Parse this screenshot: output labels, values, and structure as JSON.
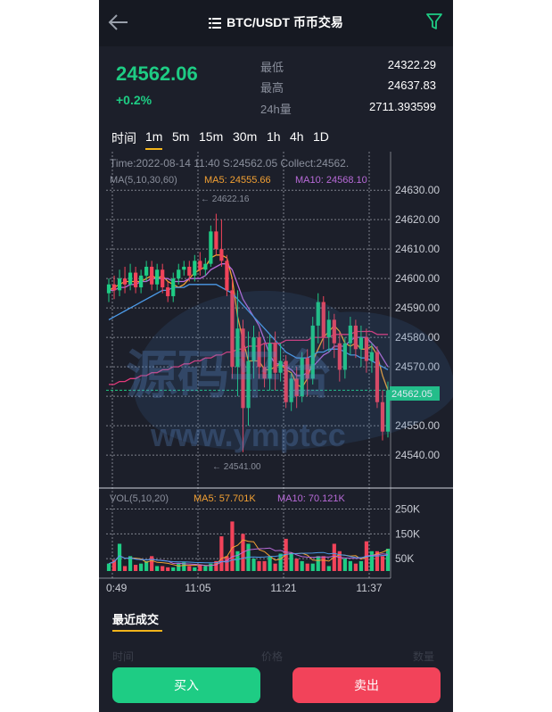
{
  "header": {
    "title": "BTC/USDT 币币交易",
    "back_icon": "arrow-left-icon",
    "menu_icon": "list-icon",
    "filter_icon": "filter-icon"
  },
  "ticker": {
    "price": "24562.06",
    "change": "+0.2%",
    "stats": [
      {
        "label": "最低",
        "value": "24322.29"
      },
      {
        "label": "最高",
        "value": "24637.83"
      },
      {
        "label": "24h量",
        "value": "2711.393599"
      }
    ]
  },
  "intervals": {
    "items": [
      "时间",
      "1m",
      "5m",
      "15m",
      "30m",
      "1h",
      "4h",
      "1D"
    ],
    "active": "1m"
  },
  "chart_info": {
    "info_line": "Time:2022-08-14 11:40     S:24562.05     Collect:24562.",
    "ma_label": "MA(5,10,30,60)",
    "ma5": "MA5: 24555.66",
    "ma10": "MA10: 24568.10",
    "high_marker": "← 24622.16",
    "low_marker": "← 24541.00",
    "current_price": "24562.05",
    "vol_label": "VOL(5,10,20)",
    "vol_ma5": "MA5: 57.701K",
    "vol_ma10": "MA10: 70.121K"
  },
  "watermark": {
    "text": "源码平台",
    "url": "www.ymptcc"
  },
  "chart_data": {
    "type": "candlestick",
    "price_axis": [
      "24630.00",
      "24620.00",
      "24610.00",
      "24600.00",
      "24590.00",
      "24580.00",
      "24570.00",
      "24560.00",
      "24550.00",
      "24540.00"
    ],
    "ylim": [
      24537,
      24634
    ],
    "volume_axis": [
      "250K",
      "150K",
      "50K"
    ],
    "time_axis": [
      "0:49",
      "11:05",
      "11:21",
      "11:37"
    ],
    "candles": [
      [
        24595,
        24598,
        24592,
        24600
      ],
      [
        24598,
        24596,
        24593,
        24601
      ],
      [
        24596,
        24600,
        24594,
        24603
      ],
      [
        24600,
        24598,
        24595,
        24604
      ],
      [
        24598,
        24602,
        24596,
        24605
      ],
      [
        24602,
        24597,
        24595,
        24604
      ],
      [
        24597,
        24601,
        24595,
        24603
      ],
      [
        24601,
        24604,
        24599,
        24606
      ],
      [
        24604,
        24598,
        24596,
        24606
      ],
      [
        24598,
        24603,
        24596,
        24605
      ],
      [
        24603,
        24597,
        24595,
        24605
      ],
      [
        24597,
        24594,
        24592,
        24599
      ],
      [
        24594,
        24600,
        24592,
        24602
      ],
      [
        24600,
        24603,
        24598,
        24605
      ],
      [
        24603,
        24604,
        24601,
        24606
      ],
      [
        24604,
        24601,
        24599,
        24606
      ],
      [
        24601,
        24606,
        24599,
        24608
      ],
      [
        24606,
        24603,
        24601,
        24609
      ],
      [
        24603,
        24605,
        24601,
        24607
      ],
      [
        24605,
        24616,
        24604,
        24618
      ],
      [
        24616,
        24610,
        24608,
        24622
      ],
      [
        24610,
        24606,
        24604,
        24620
      ],
      [
        24606,
        24596,
        24594,
        24608
      ],
      [
        24596,
        24570,
        24566,
        24600
      ],
      [
        24570,
        24583,
        24560,
        24596
      ],
      [
        24583,
        24556,
        24541,
        24586
      ],
      [
        24556,
        24572,
        24550,
        24582
      ],
      [
        24572,
        24580,
        24566,
        24584
      ],
      [
        24580,
        24570,
        24566,
        24582
      ],
      [
        24570,
        24566,
        24563,
        24578
      ],
      [
        24566,
        24578,
        24562,
        24581
      ],
      [
        24578,
        24568,
        24562,
        24582
      ],
      [
        24568,
        24572,
        24565,
        24578
      ],
      [
        24572,
        24558,
        24556,
        24574
      ],
      [
        24558,
        24566,
        24555,
        24568
      ],
      [
        24566,
        24560,
        24556,
        24570
      ],
      [
        24560,
        24573,
        24558,
        24575
      ],
      [
        24573,
        24566,
        24560,
        24576
      ],
      [
        24566,
        24584,
        24564,
        24587
      ],
      [
        24584,
        24592,
        24578,
        24595
      ],
      [
        24592,
        24580,
        24576,
        24594
      ],
      [
        24580,
        24586,
        24575,
        24589
      ],
      [
        24586,
        24578,
        24573,
        24588
      ],
      [
        24578,
        24569,
        24565,
        24582
      ],
      [
        24569,
        24578,
        24566,
        24580
      ],
      [
        24578,
        24584,
        24574,
        24587
      ],
      [
        24584,
        24576,
        24573,
        24586
      ],
      [
        24576,
        24580,
        24570,
        24584
      ],
      [
        24580,
        24572,
        24568,
        24583
      ],
      [
        24572,
        24575,
        24568,
        24578
      ],
      [
        24575,
        24558,
        24556,
        24577
      ],
      [
        24558,
        24548,
        24545,
        24562
      ],
      [
        24548,
        24562,
        24546,
        24565
      ]
    ],
    "volumes": [
      30,
      45,
      110,
      20,
      60,
      25,
      30,
      40,
      60,
      20,
      20,
      15,
      15,
      30,
      35,
      20,
      15,
      25,
      20,
      30,
      40,
      140,
      60,
      200,
      80,
      150,
      110,
      50,
      40,
      40,
      60,
      30,
      70,
      130,
      70,
      50,
      40,
      30,
      30,
      60,
      60,
      20,
      110,
      80,
      50,
      40,
      30,
      40,
      120,
      80,
      80,
      60,
      90
    ],
    "series": [
      {
        "name": "MA5",
        "color": "#f2a033",
        "values": [
          24596,
          24597,
          24598,
          24599,
          24599,
          24599,
          24599,
          24600,
          24601,
          24600,
          24601,
          24599,
          24598,
          24597,
          24598,
          24600,
          24602,
          24603,
          24604,
          24607,
          24608,
          24608,
          24607,
          24600,
          24587,
          24579,
          24572,
          24572,
          24572,
          24569,
          24569,
          24570,
          24571,
          24569,
          24568,
          24564,
          24563,
          24566,
          24572,
          24576,
          24580,
          24582,
          24584,
          24582,
          24578,
          24577,
          24578,
          24576,
          24576,
          24577,
          24574,
          24567,
          24562
        ]
      },
      {
        "name": "MA10",
        "color": "#b86ad8",
        "values": [
          24596,
          24596,
          24597,
          24597,
          24598,
          24598,
          24599,
          24599,
          24600,
          24600,
          24600,
          24600,
          24599,
          24599,
          24599,
          24600,
          24600,
          24600,
          24601,
          24603,
          24604,
          24605,
          24605,
          24603,
          24598,
          24593,
          24590,
          24587,
          24584,
          24579,
          24574,
          24571,
          24571,
          24570,
          24569,
          24567,
          24567,
          24568,
          24570,
          24572,
          24574,
          24575,
          24577,
          24577,
          24577,
          24579,
          24580,
          24580,
          24580,
          24578,
          24576,
          24573,
          24570
        ]
      },
      {
        "name": "MA30",
        "color": "#4c9ae8",
        "values": [
          24586,
          24587,
          24588,
          24589,
          24590,
          24591,
          24592,
          24593,
          24594,
          24595,
          24596,
          24596,
          24597,
          24597,
          24597,
          24598,
          24598,
          24598,
          24598,
          24598,
          24598,
          24597,
          24596,
          24595,
          24593,
          24591,
          24589,
          24587,
          24585,
          24583,
          24581,
          24579,
          24577,
          24575,
          24574,
          24573,
          24573,
          24573,
          24574,
          24575,
          24575,
          24576,
          24576,
          24576,
          24575,
          24574,
          24574,
          24573,
          24573,
          24572,
          24571,
          24570,
          24569
        ]
      },
      {
        "name": "MA60",
        "color": "#e2397a",
        "values": [
          24564,
          24564,
          24565,
          24565,
          24566,
          24566,
          24567,
          24567,
          24568,
          24568,
          24569,
          24569,
          24570,
          24570,
          24571,
          24571,
          24572,
          24572,
          24573,
          24573,
          24574,
          24574,
          24575,
          24575,
          24576,
          24576,
          24577,
          24577,
          24577,
          24578,
          24578,
          24578,
          24578,
          24579,
          24579,
          24579,
          24579,
          24579,
          24580,
          24580,
          24580,
          24580,
          24581,
          24581,
          24581,
          24581,
          24582,
          24582,
          24582,
          24582,
          24581,
          24581,
          24581
        ]
      }
    ]
  },
  "recent": {
    "title": "最近成交",
    "columns": [
      "时间",
      "价格",
      "数量"
    ]
  },
  "actions": {
    "buy": "买入",
    "sell": "卖出"
  },
  "colors": {
    "up": "#1ecc84",
    "down": "#f2435a",
    "accent": "#f2b41b",
    "background": "#1c1f2a"
  }
}
